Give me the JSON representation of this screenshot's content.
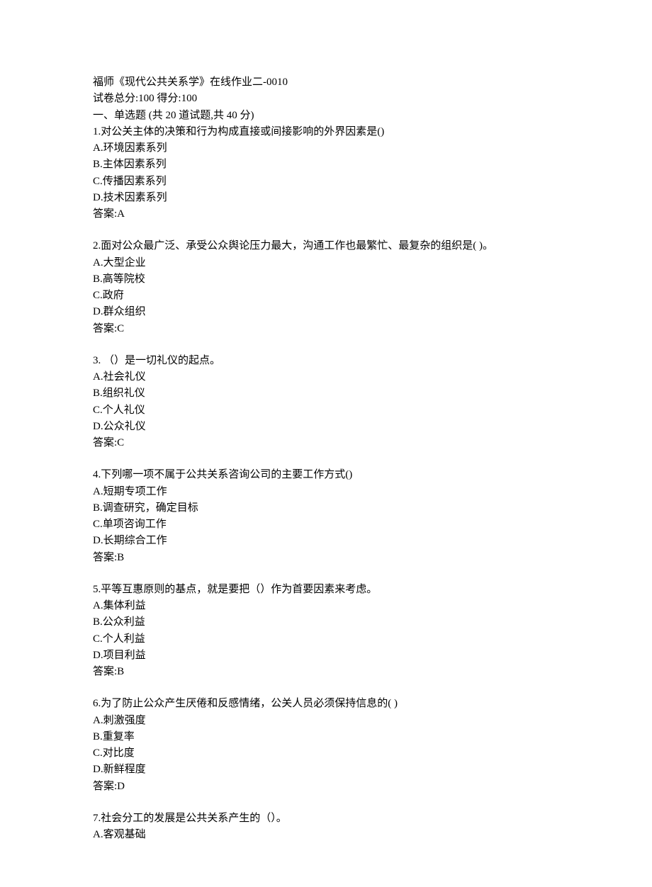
{
  "header": {
    "title": "福师《现代公共关系学》在线作业二-0010",
    "scoreLine": "试卷总分:100    得分:100",
    "sectionTitle": "一、单选题  (共  20  道试题,共  40  分)"
  },
  "questions": [
    {
      "stem": "1.对公关主体的决策和行为构成直接或间接影响的外界因素是()",
      "options": [
        "A.环境因素系列",
        "B.主体因素系列",
        "C.传播因素系列",
        "D.技术因素系列"
      ],
      "answer": "答案:A"
    },
    {
      "stem": "2.面对公众最广泛、承受公众舆论压力最大，沟通工作也最繁忙、最复杂的组织是( )。",
      "options": [
        "A.大型企业",
        "B.高等院校",
        "C.政府",
        "D.群众组织"
      ],
      "answer": "答案:C"
    },
    {
      "stem": "3. （）是一切礼仪的起点。",
      "options": [
        "A.社会礼仪",
        "B.组织礼仪",
        "C.个人礼仪",
        "D.公众礼仪"
      ],
      "answer": "答案:C"
    },
    {
      "stem": "4.下列哪一项不属于公共关系咨询公司的主要工作方式()",
      "options": [
        "A.短期专项工作",
        "B.调查研究，确定目标",
        "C.单项咨询工作",
        "D.长期综合工作"
      ],
      "answer": "答案:B"
    },
    {
      "stem": "5.平等互惠原则的基点，就是要把（）作为首要因素来考虑。",
      "options": [
        "A.集体利益",
        "B.公众利益",
        "C.个人利益",
        "D.项目利益"
      ],
      "answer": "答案:B"
    },
    {
      "stem": "6.为了防止公众产生厌倦和反感情绪，公关人员必须保持信息的( )",
      "options": [
        "A.刺激强度",
        "B.重复率",
        "C.对比度",
        "D.新鲜程度"
      ],
      "answer": "答案:D"
    },
    {
      "stem": "7.社会分工的发展是公共关系产生的（）。",
      "options": [
        "A.客观基础"
      ],
      "answer": null
    }
  ]
}
